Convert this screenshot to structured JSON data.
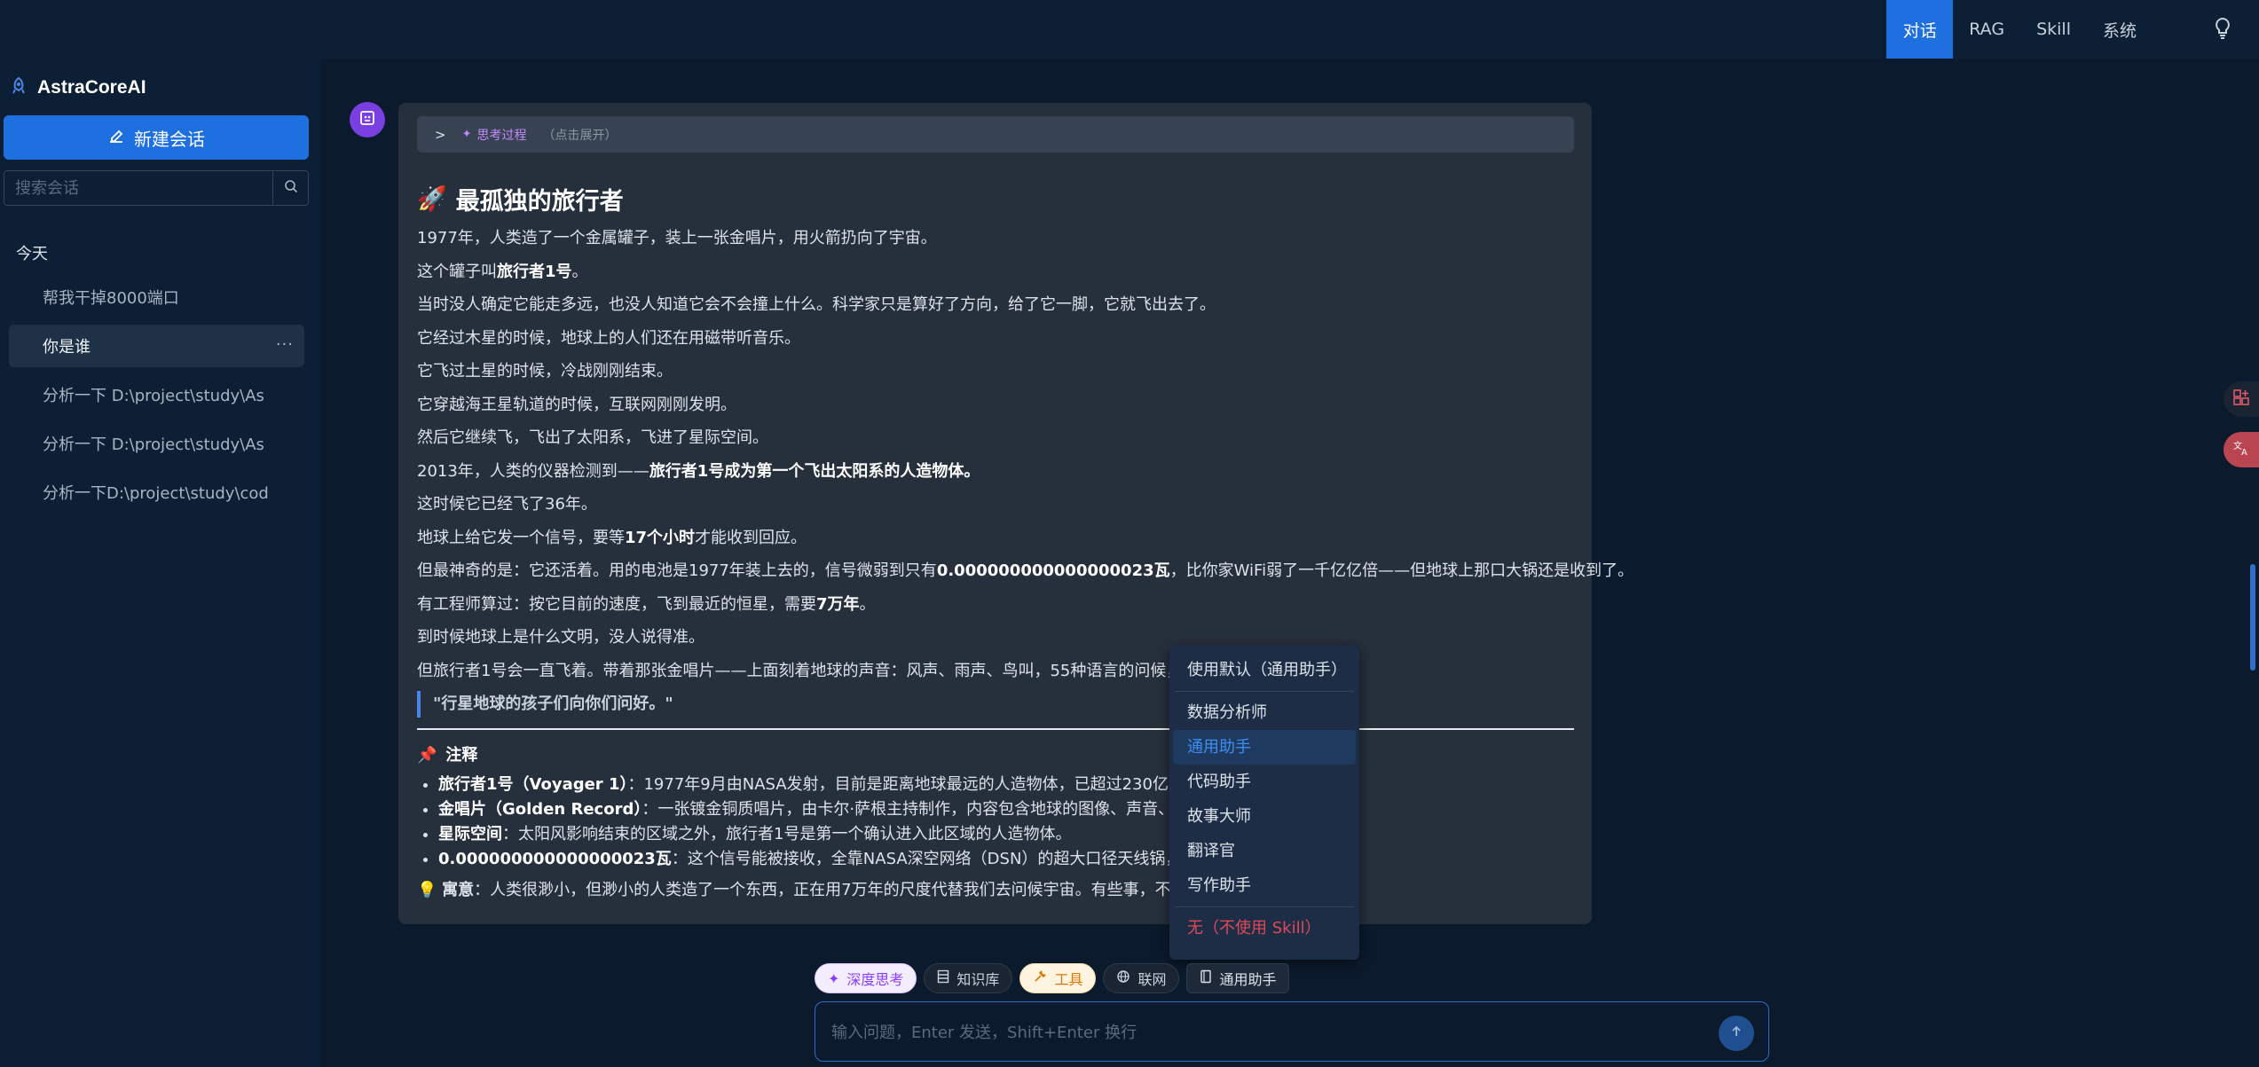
{
  "topnav": {
    "items": [
      {
        "label": "对话",
        "active": true
      },
      {
        "label": "RAG"
      },
      {
        "label": "Skill"
      },
      {
        "label": "系统"
      }
    ],
    "right_icon": "lightbulb-icon"
  },
  "sidebar": {
    "brand": "AstraCoreAI",
    "new_chat_label": "新建会话",
    "search_placeholder": "搜索会话",
    "group_label": "今天",
    "conversations": [
      {
        "title": "帮我干掉8000端口"
      },
      {
        "title": "你是谁",
        "active": true
      },
      {
        "title": "分析一下 D:\\project\\study\\As"
      },
      {
        "title": "分析一下 D:\\project\\study\\As"
      },
      {
        "title": "分析一下D:\\project\\study\\cod"
      }
    ]
  },
  "message": {
    "thinking_label": "思考过程",
    "thinking_hint": "（点击展开）",
    "title": "最孤独的旅行者",
    "title_icon": "🚀",
    "paragraphs": [
      [
        "1977年，人类造了一个金属罐子，装上一张金唱片，用火箭扔向了宇宙。"
      ],
      [
        "这个罐子叫",
        {
          "b": "旅行者1号"
        },
        "。"
      ],
      [
        "当时没人确定它能走多远，也没人知道它会不会撞上什么。科学家只是算好了方向，给了它一脚，它就飞出去了。"
      ],
      [
        "它经过木星的时候，地球上的人们还在用磁带听音乐。"
      ],
      [
        "它飞过土星的时候，冷战刚刚结束。"
      ],
      [
        "它穿越海王星轨道的时候，互联网刚刚发明。"
      ],
      [
        "然后它继续飞，飞出了太阳系，飞进了星际空间。"
      ],
      [
        "2013年，人类的仪器检测到——",
        {
          "b": "旅行者1号成为第一个飞出太阳系的人造物体。"
        }
      ],
      [
        "这时候它已经飞了36年。"
      ],
      [
        "地球上给它发一个信号，要等",
        {
          "b": "17个小时"
        },
        "才能收到回应。"
      ],
      [
        "但最神奇的是：它还活着。用的电池是1977年装上去的，信号微弱到只有",
        {
          "b": "0.000000000000000023瓦"
        },
        "，比你家WiFi弱了一千亿亿倍——但地球上那口大锅还是收到了。"
      ],
      [
        "有工程师算过：按它目前的速度，飞到最近的恒星，需要",
        {
          "b": "7万年"
        },
        "。"
      ],
      [
        "到时候地球上是什么文明，没人说得准。"
      ],
      [
        "但旅行者1号会一直飞着。带着那张金唱片——上面刻着地球的声音：风声、雨声、鸟叫，55种语言的问候，还"
      ]
    ],
    "quote": "\"行星地球的孩子们向你们问好。\"",
    "notes_title": "注释",
    "notes_icon": "📌",
    "notes": [
      {
        "term": "旅行者1号（Voyager 1）",
        "text": "：1977年9月由NASA发射，目前是距离地球最远的人造物体，已超过230亿公里"
      },
      {
        "term": "金唱片（Golden Record）",
        "text": "：一张镀金铜质唱片，由卡尔·萨根主持制作，内容包含地球的图像、声音、音乐，以及 能了解人类。"
      },
      {
        "term": "星际空间",
        "text": "：太阳风影响结束的区域之外，旅行者1号是第一个确认进入此区域的人造物体。"
      },
      {
        "term": "0.000000000000000023瓦",
        "text": "：这个信号能被接收，全靠NASA深空网络（DSN）的超大口径天线锅，口径"
      }
    ],
    "meaning_icon": "💡",
    "meaning_term": "寓意",
    "meaning_text": "：人类很渺小，但渺小的人类造了一个东西，正在用7万年的尺度代替我们去问候宇宙。有些事，不是"
  },
  "skill_dropdown": {
    "default_label": "使用默认（通用助手）",
    "options": [
      "数据分析师",
      "通用助手",
      "代码助手",
      "故事大师",
      "翻译官",
      "写作助手"
    ],
    "selected": "通用助手",
    "none_label": "无（不使用 Skill）"
  },
  "toolbar": {
    "deep_think": "深度思考",
    "knowledge_base": "知识库",
    "tools": "工具",
    "web": "联网",
    "skill": "通用助手"
  },
  "input": {
    "placeholder": "输入问题，Enter 发送，Shift+Enter 换行"
  },
  "colors": {
    "accent": "#1e6fe0",
    "sidebar_bg": "#0d1f35",
    "bubble_bg": "#262f3c",
    "thinking_purple": "#c58af9",
    "danger": "#e0495a"
  }
}
